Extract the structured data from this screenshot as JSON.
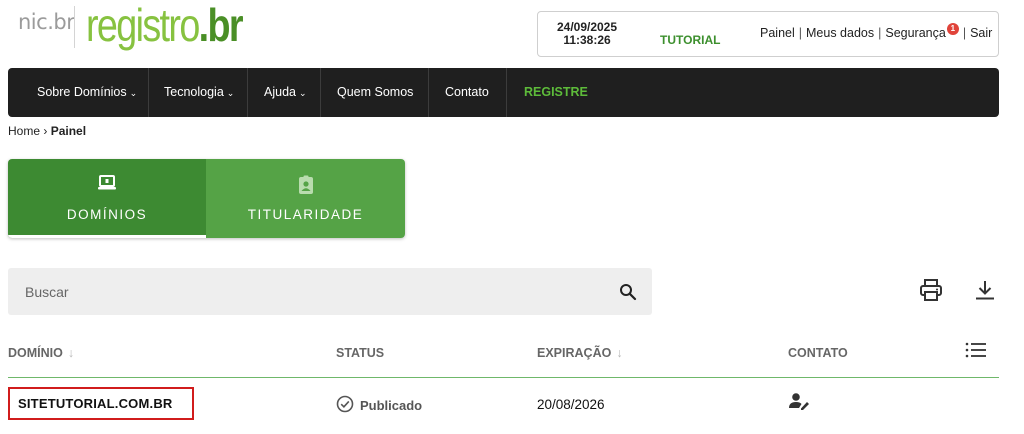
{
  "header": {
    "logo_nic": "nic.br",
    "logo_registro": "registro",
    "logo_br": ".br",
    "date": "24/09/2025",
    "time": "11:38:26",
    "mode": "TUTORIAL",
    "links": {
      "painel": "Painel",
      "meus_dados": "Meus dados",
      "seguranca": "Segurança",
      "seguranca_badge": "1",
      "sair": "Sair"
    }
  },
  "nav": {
    "items": [
      {
        "label": "Sobre Domínios"
      },
      {
        "label": "Tecnologia"
      },
      {
        "label": "Ajuda"
      },
      {
        "label": "Quem Somos"
      },
      {
        "label": "Contato"
      },
      {
        "label": "REGISTRE"
      }
    ]
  },
  "breadcrumb": {
    "home": "Home",
    "separator": "›",
    "current": "Painel"
  },
  "tabs": [
    {
      "label": "DOMÍNIOS",
      "icon": "laptop-icon",
      "active": true
    },
    {
      "label": "TITULARIDADE",
      "icon": "badge-icon",
      "active": false
    }
  ],
  "search": {
    "placeholder": "Buscar",
    "value": ""
  },
  "table": {
    "headers": {
      "domain": "DOMÍNIO",
      "status": "STATUS",
      "expiration": "EXPIRAÇÃO",
      "contact": "CONTATO"
    },
    "rows": [
      {
        "domain": "SITETUTORIAL.COM.BR",
        "status": "Publicado",
        "expiration": "20/08/2026",
        "contact_icon": "user-edit-icon"
      }
    ]
  },
  "colors": {
    "brand_green_light": "#87c240",
    "brand_green_dark": "#4a8f26",
    "tab_active": "#3d8a32",
    "tab_inactive": "#55a346",
    "nav_bg": "#1f1f1f",
    "register_green": "#5dbb3a",
    "highlight_red": "#d11c1c"
  }
}
